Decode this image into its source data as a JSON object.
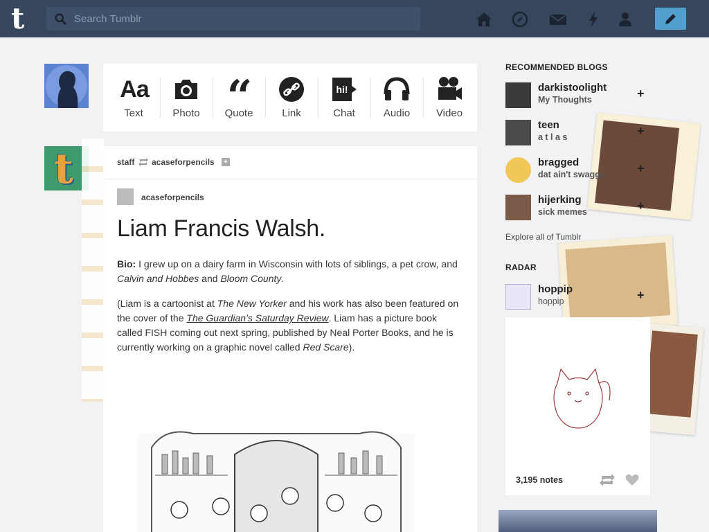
{
  "search": {
    "placeholder": "Search Tumblr"
  },
  "nav": {
    "icons": [
      "home-icon",
      "explore-icon",
      "inbox-icon",
      "activity-icon",
      "account-icon",
      "compose-icon"
    ]
  },
  "post_types": [
    {
      "label": "Text",
      "icon": "text-icon"
    },
    {
      "label": "Photo",
      "icon": "camera-icon"
    },
    {
      "label": "Quote",
      "icon": "quote-icon"
    },
    {
      "label": "Link",
      "icon": "link-icon"
    },
    {
      "label": "Chat",
      "icon": "chat-icon"
    },
    {
      "label": "Audio",
      "icon": "headphones-icon"
    },
    {
      "label": "Video",
      "icon": "video-camera-icon"
    }
  ],
  "post": {
    "reblogger": "staff",
    "source": "acaseforpencils",
    "author": "acaseforpencils",
    "title": "Liam Francis Walsh.",
    "bio_label": "Bio:",
    "bio_text_1": " I grew up on a dairy farm in Wisconsin with lots of siblings, a pet crow, and ",
    "bio_italic_1": "Calvin and Hobbes",
    "bio_and": " and ",
    "bio_italic_2": "Bloom County",
    "bio_end": ".",
    "para2_1": "(Liam is a cartoonist at ",
    "para2_it1": "The New Yorker",
    "para2_2": " and his work has also been featured on the cover of the ",
    "para2_link": "The Guardian’s Saturday Review",
    "para2_3": ". Liam has a picture book called FISH coming out next spring, published by Neal Porter Books, and he is currently working on a graphic novel called ",
    "para2_it2": "Red Scare",
    "para2_4": ")."
  },
  "sidebar": {
    "recommended_title": "RECOMMENDED BLOGS",
    "blogs": [
      {
        "name": "darkistoolight",
        "sub": "My Thoughts"
      },
      {
        "name": "teen",
        "sub": "a t l a s"
      },
      {
        "name": "bragged",
        "sub": "dat ain't swaggy"
      },
      {
        "name": "hijerking",
        "sub": "sick memes"
      }
    ],
    "explore": "Explore all of Tumblr",
    "radar_title": "RADAR",
    "radar": {
      "name": "hoppip",
      "sub": "hoppip",
      "notes": "3,195 notes"
    }
  },
  "colors": {
    "nav_bg": "#36465d",
    "page_bg": "#f1f2f4",
    "compose": "#529ecc",
    "staff_avatar": "#3c9a6c",
    "user_avatar": "#5b83d2"
  }
}
